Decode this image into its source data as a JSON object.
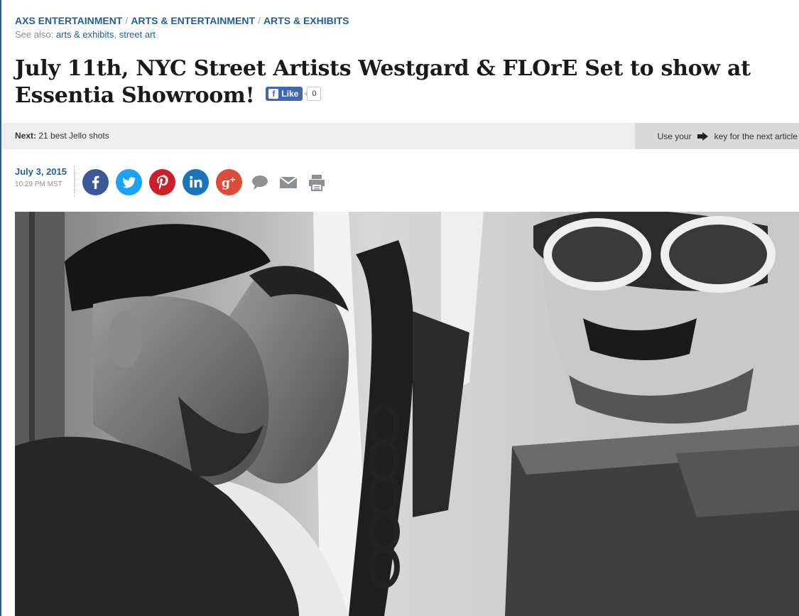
{
  "breadcrumb": {
    "items": [
      "AXS ENTERTAINMENT",
      "ARTS & ENTERTAINMENT",
      "ARTS & EXHIBITS"
    ],
    "separator": "/"
  },
  "see_also": {
    "label": "See also:",
    "links": [
      "arts & exhibits",
      "street art"
    ]
  },
  "article": {
    "title": "July 11th, NYC Street Artists Westgard & FLOrE Set to show at Essentia Showroom!",
    "date": "July 3, 2015",
    "time": "10:29 PM MST"
  },
  "fb_like": {
    "label": "Like",
    "count": "0"
  },
  "next_bar": {
    "prefix": "Next:",
    "next_title": "21 best Jello shots",
    "hint_before": "Use your",
    "hint_after": "key for the next article"
  },
  "share_icons": [
    "facebook-icon",
    "twitter-icon",
    "pinterest-icon",
    "linkedin-icon",
    "google-plus-icon",
    "comment-icon",
    "email-icon",
    "print-icon"
  ],
  "colors": {
    "link_blue": "#1f5f99",
    "facebook": "#3b5998",
    "twitter": "#1da1f2",
    "pinterest": "#cb2027",
    "linkedin": "#1b75bb",
    "google_plus": "#dd4b39"
  }
}
